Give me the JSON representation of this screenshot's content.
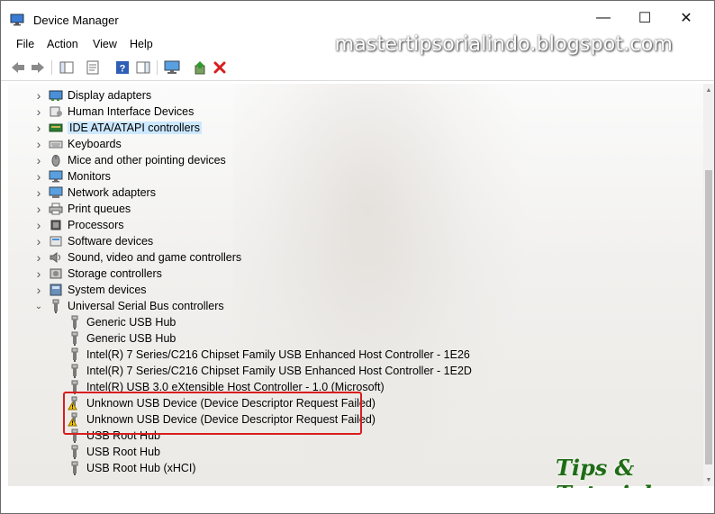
{
  "window": {
    "title": "Device Manager",
    "minimize": "—",
    "maximize": "☐",
    "close": "✕"
  },
  "menu": [
    "File",
    "Action",
    "View",
    "Help"
  ],
  "watermark": "mastertipsorialindo.blogspot.com",
  "toolbar": [
    "back-icon",
    "forward-icon",
    "show-hide-console-tree-icon",
    "properties-icon",
    "help-icon",
    "action-pane-icon",
    "computer-icon",
    "update-driver-icon",
    "uninstall-icon"
  ],
  "categories": [
    {
      "label": "Display adapters",
      "icon": "display-adapter-icon",
      "expanded": false
    },
    {
      "label": "Human Interface Devices",
      "icon": "hid-icon",
      "expanded": false
    },
    {
      "label": "IDE ATA/ATAPI controllers",
      "icon": "ide-controller-icon",
      "expanded": false,
      "selected": true
    },
    {
      "label": "Keyboards",
      "icon": "keyboard-icon",
      "expanded": false
    },
    {
      "label": "Mice and other pointing devices",
      "icon": "mouse-icon",
      "expanded": false
    },
    {
      "label": "Monitors",
      "icon": "monitor-icon",
      "expanded": false
    },
    {
      "label": "Network adapters",
      "icon": "network-adapter-icon",
      "expanded": false
    },
    {
      "label": "Print queues",
      "icon": "printer-icon",
      "expanded": false
    },
    {
      "label": "Processors",
      "icon": "processor-icon",
      "expanded": false
    },
    {
      "label": "Software devices",
      "icon": "software-device-icon",
      "expanded": false
    },
    {
      "label": "Sound, video and game controllers",
      "icon": "sound-icon",
      "expanded": false
    },
    {
      "label": "Storage controllers",
      "icon": "storage-controller-icon",
      "expanded": false
    },
    {
      "label": "System devices",
      "icon": "system-device-icon",
      "expanded": false
    },
    {
      "label": "Universal Serial Bus controllers",
      "icon": "usb-controller-icon",
      "expanded": true
    }
  ],
  "usb_devices": [
    {
      "label": "Generic USB Hub",
      "warning": false
    },
    {
      "label": "Generic USB Hub",
      "warning": false
    },
    {
      "label": "Intel(R) 7 Series/C216 Chipset Family USB Enhanced Host Controller - 1E26",
      "warning": false
    },
    {
      "label": "Intel(R) 7 Series/C216 Chipset Family USB Enhanced Host Controller - 1E2D",
      "warning": false
    },
    {
      "label": "Intel(R) USB 3.0 eXtensible Host Controller - 1.0 (Microsoft)",
      "warning": false
    },
    {
      "label": "Unknown USB Device (Device Descriptor Request Failed)",
      "warning": true
    },
    {
      "label": "Unknown USB Device (Device Descriptor Request Failed)",
      "warning": true
    },
    {
      "label": "USB Root Hub",
      "warning": false
    },
    {
      "label": "USB Root Hub",
      "warning": false
    },
    {
      "label": "USB Root Hub (xHCI)",
      "warning": false
    }
  ],
  "brand": "Tips & Tutorial",
  "colors": {
    "selection": "#cce8ff",
    "highlight": "#d81e1e",
    "warning": "#f2c200",
    "brand": "#1f6b17"
  }
}
